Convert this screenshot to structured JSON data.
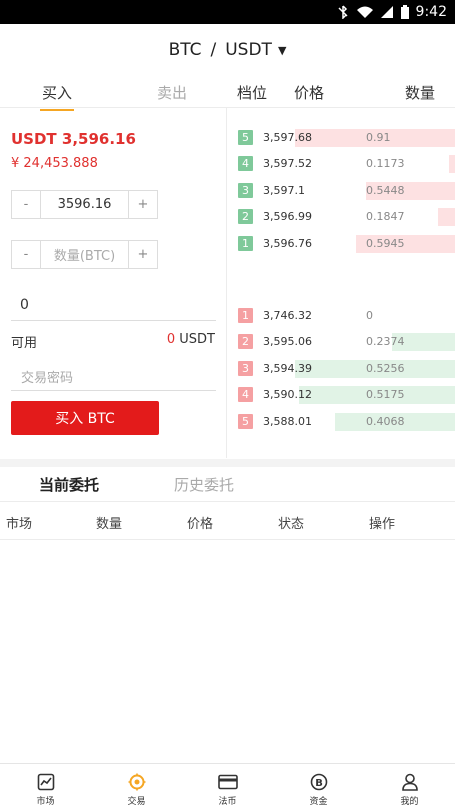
{
  "status_bar": {
    "time": "9:42"
  },
  "header": {
    "pair_base": "BTC",
    "pair_sep": "/",
    "pair_quote": "USDT"
  },
  "tabs": {
    "buy": "买入",
    "sell": "卖出"
  },
  "book_headers": {
    "level": "档位",
    "price": "价格",
    "qty": "数量"
  },
  "trade": {
    "price_usdt": "USDT 3,596.16",
    "price_cny": "¥ 24,453.888",
    "price_input": "3596.16",
    "qty_placeholder": "数量(BTC)",
    "minus": "-",
    "plus": "+",
    "amount": "0",
    "available_label": "可用",
    "available_value": "0",
    "available_unit": " USDT",
    "password_placeholder": "交易密码",
    "buy_button": "买入 BTC"
  },
  "asks": [
    {
      "level": "5",
      "price": "3,597.68",
      "qty": "0.91",
      "depth": 0.84
    },
    {
      "level": "4",
      "price": "3,597.52",
      "qty": "0.1173",
      "depth": 0.03
    },
    {
      "level": "3",
      "price": "3,597.1",
      "qty": "0.5448",
      "depth": 0.47
    },
    {
      "level": "2",
      "price": "3,596.99",
      "qty": "0.1847",
      "depth": 0.09
    },
    {
      "level": "1",
      "price": "3,596.76",
      "qty": "0.5945",
      "depth": 0.52
    }
  ],
  "bids": [
    {
      "level": "1",
      "price": "3,746.32",
      "qty": "0",
      "depth": 0
    },
    {
      "level": "2",
      "price": "3,595.06",
      "qty": "0.2374",
      "depth": 0.33
    },
    {
      "level": "3",
      "price": "3,594.39",
      "qty": "0.5256",
      "depth": 0.84
    },
    {
      "level": "4",
      "price": "3,590.12",
      "qty": "0.5175",
      "depth": 0.82
    },
    {
      "level": "5",
      "price": "3,588.01",
      "qty": "0.4068",
      "depth": 0.63
    }
  ],
  "orders": {
    "current_tab": "当前委托",
    "history_tab": "历史委托",
    "columns": [
      "市场",
      "数量",
      "价格",
      "状态",
      "操作"
    ]
  },
  "nav": [
    {
      "label": "市场",
      "icon": "chart-icon"
    },
    {
      "label": "交易",
      "icon": "trade-icon"
    },
    {
      "label": "法币",
      "icon": "card-icon"
    },
    {
      "label": "资金",
      "icon": "bitcoin-icon"
    },
    {
      "label": "我的",
      "icon": "user-icon"
    }
  ],
  "colors": {
    "red": "#e0312f",
    "accent": "#f5a623",
    "ask_bg": "#fde1e2",
    "bid_bg": "#e1f3e6"
  }
}
